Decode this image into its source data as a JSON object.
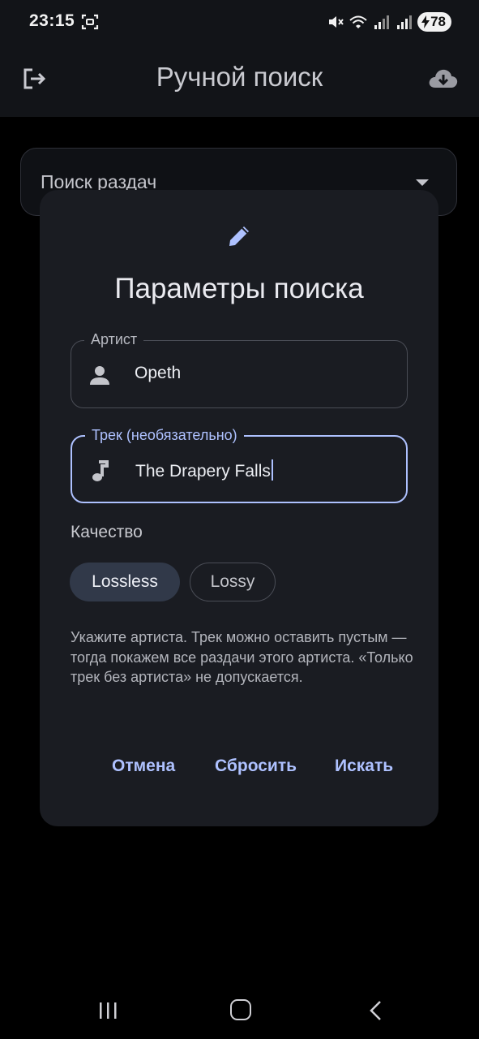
{
  "status_bar": {
    "time": "23:15",
    "battery": "78",
    "icons": [
      "screenshot-icon",
      "mute-icon",
      "wifi-icon",
      "signal-icon",
      "signal-icon",
      "battery-charging-icon"
    ]
  },
  "app_bar": {
    "title": "Ручной поиск",
    "left_icon": "logout-icon",
    "right_icon": "cloud-download-icon"
  },
  "background": {
    "dropdown_label": "Поиск раздач"
  },
  "dialog": {
    "icon": "pencil-icon",
    "title": "Параметры поиска",
    "artist_field": {
      "label": "Артист",
      "value": "Opeth",
      "icon": "person-icon"
    },
    "track_field": {
      "label": "Трек (необязательно)",
      "value": "The Drapery Falls",
      "icon": "music-note-icon"
    },
    "quality_label": "Качество",
    "quality_options": [
      {
        "label": "Lossless",
        "selected": true
      },
      {
        "label": "Lossy",
        "selected": false
      }
    ],
    "hint": "Укажите артиста. Трек можно оставить пустым — тогда покажем все раздачи этого артиста. «Только трек без артиста» не допускается.",
    "buttons": {
      "cancel": "Отмена",
      "reset": "Сбросить",
      "search": "Искать"
    }
  },
  "colors": {
    "accent": "#aec1ff",
    "dialog_bg": "#1a1c22",
    "selected_chip": "#313949"
  }
}
